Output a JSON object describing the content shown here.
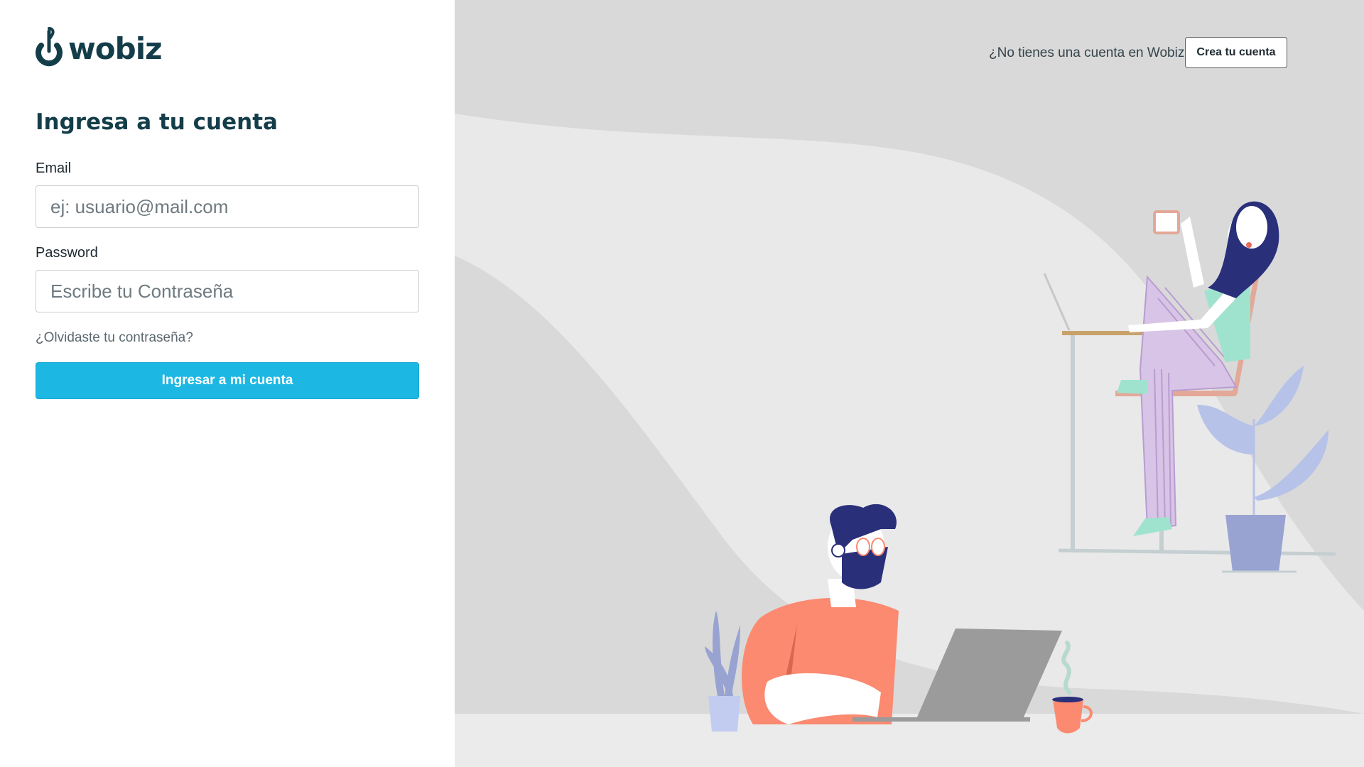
{
  "brand": {
    "name": "wobiz"
  },
  "login": {
    "title": "Ingresa a tu cuenta",
    "email_label": "Email",
    "email_placeholder": "ej: usuario@mail.com",
    "email_value": "",
    "password_label": "Password",
    "password_placeholder": "Escribe tu Contraseña",
    "password_value": "",
    "forgot_link": "¿Olvidaste tu contraseña?",
    "submit_label": "Ingresar a mi cuenta"
  },
  "signup": {
    "prompt": "¿No tienes una cuenta en Wobiz?",
    "button_label": "Crea tu cuenta"
  },
  "colors": {
    "brand_dark": "#143d4a",
    "primary_button": "#1cb8e3",
    "illustration_background": "#d9d9d9"
  },
  "icons": [
    "wobiz-logo-icon",
    "woman-working-illustration",
    "man-with-laptop-illustration"
  ]
}
